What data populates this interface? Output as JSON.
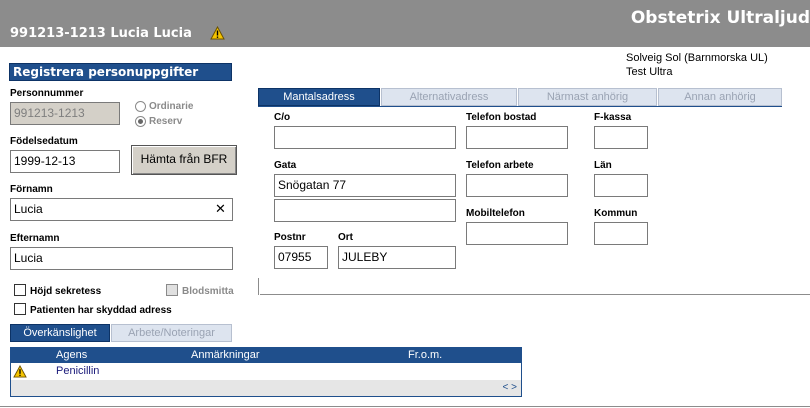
{
  "header": {
    "app_title": "Obstetrix Ultraljud",
    "patient_title": "991213-1213 Lucia Lucia"
  },
  "user": {
    "name": "Solveig Sol (Barnmorska UL)",
    "unit": "Test Ultra"
  },
  "registration": {
    "section_title": "Registrera personuppgifter",
    "personnummer_label": "Personnummer",
    "personnummer_value": "991213-1213",
    "radio_ordinarie": "Ordinarie",
    "radio_reserv": "Reserv",
    "fodelsedatum_label": "Födelsedatum",
    "fodelsedatum_value": "1999-12-13",
    "fetch_button": "Hämta från BFR",
    "fornamn_label": "Förnamn",
    "fornamn_value": "Lucia",
    "clear_glyph": "✕",
    "efternamn_label": "Efternamn",
    "efternamn_value": "Lucia",
    "hojd_sekretess": "Höjd sekretess",
    "blodsmitta": "Blodsmitta",
    "skyddad_adress": "Patienten har skyddad adress"
  },
  "lower_tabs": [
    "Överkänslighet",
    "Arbete/Noteringar"
  ],
  "allergy": {
    "columns": [
      "Agens",
      "Anmärkningar",
      "Fr.o.m."
    ],
    "rows": [
      {
        "agens": "Penicillin",
        "anmarkningar": "",
        "from": ""
      }
    ],
    "pager": "< >"
  },
  "address_tabs": [
    "Mantalsadress",
    "Alternativadress",
    "Närmast anhörig",
    "Annan anhörig"
  ],
  "address": {
    "co_label": "C/o",
    "co_value": "",
    "gata_label": "Gata",
    "gata_value": "Snögatan 77",
    "gata2_value": "",
    "postnr_label": "Postnr",
    "postnr_value": "07955",
    "ort_label": "Ort",
    "ort_value": "JULEBY",
    "telefon_bostad_label": "Telefon bostad",
    "telefon_bostad_value": "",
    "telefon_arbete_label": "Telefon arbete",
    "telefon_arbete_value": "",
    "mobiltelefon_label": "Mobiltelefon",
    "mobiltelefon_value": "",
    "fkassa_label": "F-kassa",
    "fkassa_value": "",
    "lan_label": "Län",
    "lan_value": "",
    "kommun_label": "Kommun",
    "kommun_value": ""
  },
  "colors": {
    "header_bg": "#8c8c8c",
    "accent": "#1f4f8c",
    "warning": "#f5c400"
  },
  "icons": {
    "warning": "warning-triangle-icon"
  }
}
